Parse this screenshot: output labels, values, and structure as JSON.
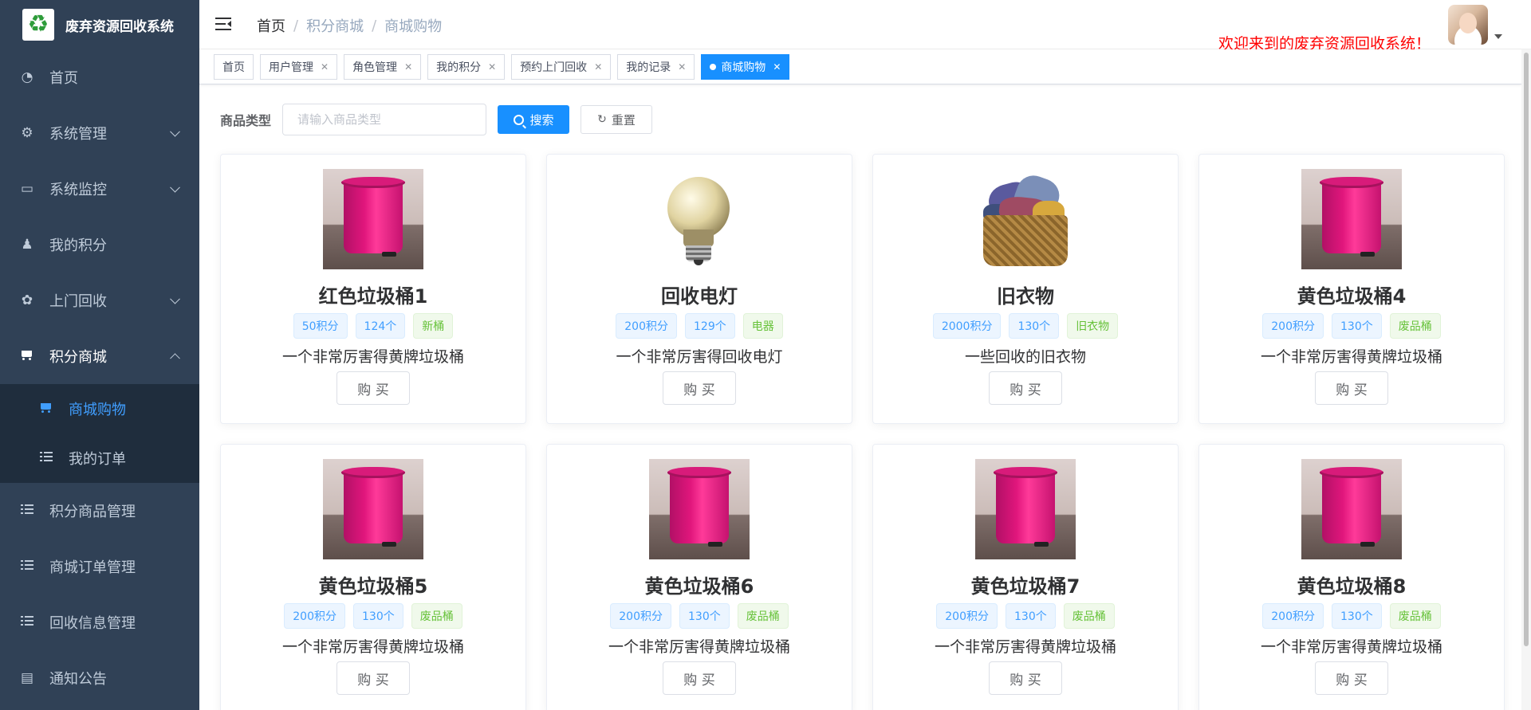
{
  "brand": {
    "title": "废弃资源回收系统",
    "logo_icon": "recycle-icon"
  },
  "sidebar": {
    "items": [
      {
        "label": "首页",
        "icon": "dashboard-icon",
        "arrow": ""
      },
      {
        "label": "系统管理",
        "icon": "gear-icon",
        "arrow": "down"
      },
      {
        "label": "系统监控",
        "icon": "monitor-icon",
        "arrow": "down"
      },
      {
        "label": "我的积分",
        "icon": "user-points-icon",
        "arrow": ""
      },
      {
        "label": "上门回收",
        "icon": "recycle-pickup-icon",
        "arrow": "down"
      },
      {
        "label": "积分商城",
        "icon": "cart-icon",
        "arrow": "up"
      }
    ],
    "submenu": [
      {
        "label": "商城购物",
        "icon": "cart-icon",
        "active": true
      },
      {
        "label": "我的订单",
        "icon": "list-icon",
        "active": false
      }
    ],
    "items_after": [
      {
        "label": "积分商品管理",
        "icon": "list-icon"
      },
      {
        "label": "商城订单管理",
        "icon": "list-icon"
      },
      {
        "label": "回收信息管理",
        "icon": "list-icon"
      },
      {
        "label": "通知公告",
        "icon": "message-icon"
      }
    ]
  },
  "header": {
    "breadcrumb": [
      "首页",
      "积分商城",
      "商城购物"
    ],
    "welcome": "欢迎来到的废弃资源回收系统！"
  },
  "tags": [
    {
      "label": "首页",
      "closable": false,
      "active": false
    },
    {
      "label": "用户管理",
      "closable": true,
      "active": false
    },
    {
      "label": "角色管理",
      "closable": true,
      "active": false
    },
    {
      "label": "我的积分",
      "closable": true,
      "active": false
    },
    {
      "label": "预约上门回收",
      "closable": true,
      "active": false
    },
    {
      "label": "我的记录",
      "closable": true,
      "active": false
    },
    {
      "label": "商城购物",
      "closable": true,
      "active": true
    }
  ],
  "search": {
    "label": "商品类型",
    "placeholder": "请输入商品类型",
    "value": "",
    "search_label": "搜索",
    "reset_label": "重置"
  },
  "products": [
    {
      "name": "红色垃圾桶1",
      "points": "50积分",
      "stock": "124个",
      "category": "新桶",
      "desc": "一个非常厉害得黄牌垃圾桶",
      "image": "bin",
      "buy_label": "购 买"
    },
    {
      "name": "回收电灯",
      "points": "200积分",
      "stock": "129个",
      "category": "电器",
      "desc": "一个非常厉害得回收电灯",
      "image": "bulb",
      "buy_label": "购 买"
    },
    {
      "name": "旧衣物",
      "points": "2000积分",
      "stock": "130个",
      "category": "旧衣物",
      "desc": "一些回收的旧衣物",
      "image": "clothes",
      "buy_label": "购 买"
    },
    {
      "name": "黄色垃圾桶4",
      "points": "200积分",
      "stock": "130个",
      "category": "废品桶",
      "desc": "一个非常厉害得黄牌垃圾桶",
      "image": "bin",
      "buy_label": "购 买"
    },
    {
      "name": "黄色垃圾桶5",
      "points": "200积分",
      "stock": "130个",
      "category": "废品桶",
      "desc": "一个非常厉害得黄牌垃圾桶",
      "image": "bin",
      "buy_label": "购 买"
    },
    {
      "name": "黄色垃圾桶6",
      "points": "200积分",
      "stock": "130个",
      "category": "废品桶",
      "desc": "一个非常厉害得黄牌垃圾桶",
      "image": "bin",
      "buy_label": "购 买"
    },
    {
      "name": "黄色垃圾桶7",
      "points": "200积分",
      "stock": "130个",
      "category": "废品桶",
      "desc": "一个非常厉害得黄牌垃圾桶",
      "image": "bin",
      "buy_label": "购 买"
    },
    {
      "name": "黄色垃圾桶8",
      "points": "200积分",
      "stock": "130个",
      "category": "废品桶",
      "desc": "一个非常厉害得黄牌垃圾桶",
      "image": "bin",
      "buy_label": "购 买"
    }
  ],
  "colors": {
    "sidebar_bg": "#304156",
    "submenu_bg": "#1f2d3d",
    "active_text": "#409eff",
    "tag_active": "#42b983",
    "primary": "#1890ff",
    "welcome": "#ff0000"
  }
}
